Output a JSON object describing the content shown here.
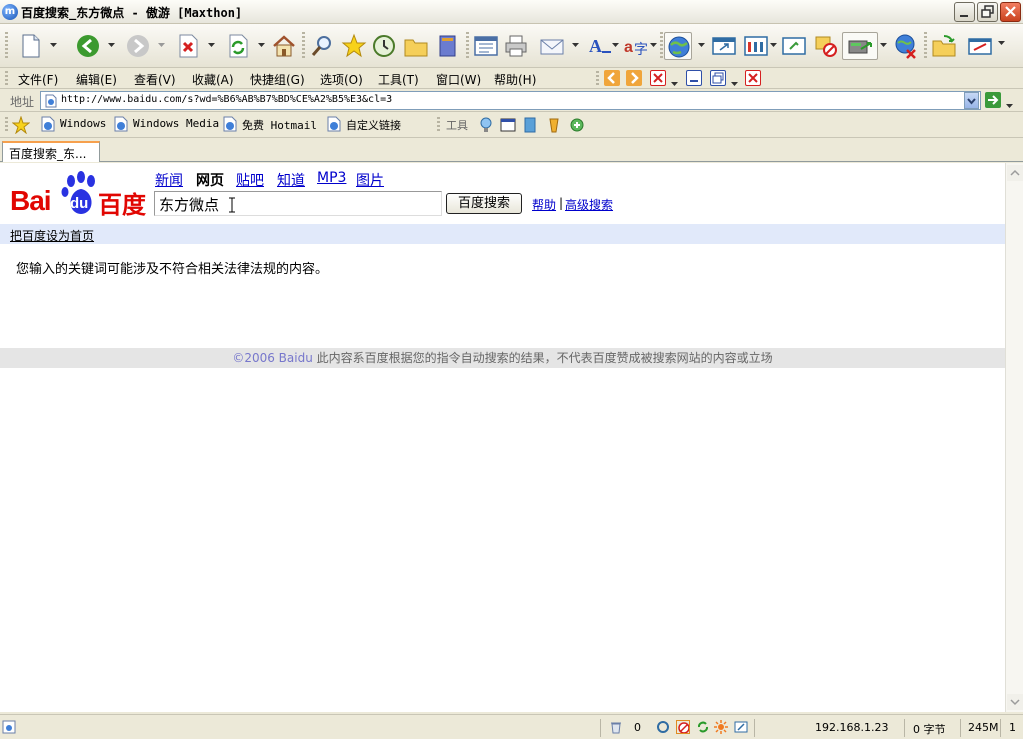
{
  "window": {
    "title": "百度搜索_东方微点 - 傲游 [Maxthon]",
    "app_icon_letter": "m"
  },
  "toolbar": {
    "buttons": [
      "new-page",
      "back",
      "forward",
      "stop",
      "refresh",
      "home",
      "search",
      "favorites",
      "history",
      "open-folder",
      "notes",
      "sidebar",
      "print",
      "mail",
      "font-size",
      "translate",
      "web",
      "new-window",
      "groups",
      "screenshot",
      "block",
      "proxy",
      "download",
      "globe-settings",
      "explorer",
      "compose"
    ]
  },
  "menu": {
    "items": [
      "文件(F)",
      "编辑(E)",
      "查看(V)",
      "收藏(A)",
      "快捷组(G)",
      "选项(O)",
      "工具(T)",
      "窗口(W)",
      "帮助(H)"
    ]
  },
  "address": {
    "label": "地址",
    "url": "http://www.baidu.com/s?wd=%B6%AB%B7%BD%CE%A2%B5%E3&cl=3"
  },
  "links": {
    "items": [
      "Windows",
      "Windows Media",
      "免费 Hotmail",
      "自定义链接"
    ],
    "tools_label": "工具"
  },
  "tabs": [
    {
      "label": "百度搜索_东..."
    }
  ],
  "page": {
    "logo": {
      "left": "Bai",
      "paw": "du",
      "right": "百度"
    },
    "nav": {
      "news": "新闻",
      "web": "网页",
      "tieba": "贴吧",
      "zhidao": "知道",
      "mp3": "MP3",
      "images": "图片"
    },
    "search": {
      "value": "东方微点",
      "button": "百度搜索",
      "help": "帮助",
      "separator": "|",
      "advanced": "高级搜索"
    },
    "set_homepage": "把百度设为首页",
    "message": "您输入的关键词可能涉及不符合相关法律法规的内容。",
    "footer": {
      "copyright": "©2006 Baidu",
      "text": " 此内容系百度根据您的指令自动搜索的结果，不代表百度赞成被搜索网站的内容或立场"
    }
  },
  "status": {
    "count": "0",
    "ip": "192.168.1.23",
    "bytes": "0 字节",
    "memory": "245M",
    "page_num": "1"
  },
  "colors": {
    "baidu_red": "#e10602",
    "baidu_blue": "#2932e1",
    "link_blue": "#0000cc",
    "home_bar": "#e1e9fa"
  }
}
